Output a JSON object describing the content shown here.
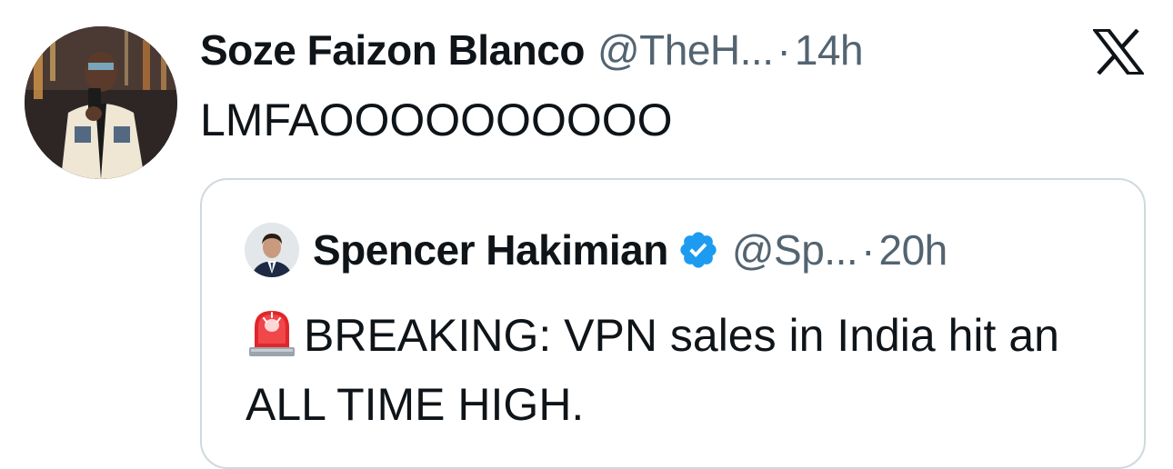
{
  "tweet": {
    "author": {
      "display_name": "Soze Faizon Blanco",
      "handle": "@TheH...",
      "time": "14h"
    },
    "separator": "·",
    "text": "LMFAOOOOOOOOOO",
    "platform_icon": "x-logo-icon"
  },
  "quoted_tweet": {
    "author": {
      "display_name": "Spencer Hakimian",
      "verified": true,
      "verified_color": "#1d9bf0",
      "handle": "@Sp...",
      "time": "20h"
    },
    "separator": "·",
    "emoji": "siren-icon",
    "text": "BREAKING: VPN sales in India hit an ALL TIME HIGH."
  },
  "colors": {
    "text_primary": "#0f1419",
    "text_secondary": "#536471",
    "border": "#cfd9de"
  }
}
